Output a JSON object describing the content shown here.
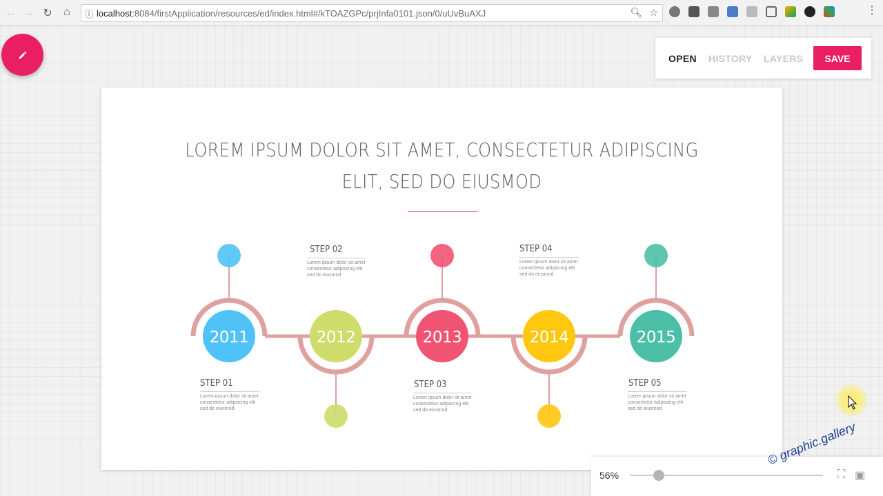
{
  "browser": {
    "url_host": "localhost",
    "url_path": ":8084/firstApplication/resources/ed/index.html#/kTOAZGPc/prjInfa0101.json/0/uUvBuAXJ"
  },
  "toolbar": {
    "open_label": "OPEN",
    "history_label": "HISTORY",
    "layers_label": "LAYERS",
    "save_label": "SAVE"
  },
  "slide": {
    "title_line1": "LOREM IPSUM DOLOR SIT AMET, CONSECTETUR ADIPISCING",
    "title_line2": "ELIT, SED DO EIUSMOD",
    "steps": [
      {
        "label": "STEP 01",
        "year": "2011",
        "color": "#4fc3f7",
        "text1": "Lorem ipsum dolor sit amet",
        "text2": "consectetur adipiscing elit",
        "text3": "sed do eiusmod"
      },
      {
        "label": "STEP 02",
        "year": "2012",
        "color": "#cddc6a",
        "text1": "Lorem ipsum dolor sit amet",
        "text2": "consectetur adipiscing elit",
        "text3": "sed do eiusmod"
      },
      {
        "label": "STEP 03",
        "year": "2013",
        "color": "#ef5472",
        "text1": "Lorem ipsum dolor sit amet",
        "text2": "consectetur adipiscing elit",
        "text3": "sed do eiusmod"
      },
      {
        "label": "STEP 04",
        "year": "2014",
        "color": "#ffc70f",
        "text1": "Lorem ipsum dolor sit amet",
        "text2": "consectetur adipiscing elit",
        "text3": "sed do eiusmod"
      },
      {
        "label": "STEP 05",
        "year": "2015",
        "color": "#4dbfa6",
        "text1": "Lorem ipsum dolor sit amet",
        "text2": "consectetur adipiscing elit",
        "text3": "sed do eiusmod"
      }
    ],
    "arc_color": "#e0a0a0"
  },
  "zoom": {
    "percent_label": "56%",
    "level": 0.56
  },
  "watermark": "© graphic.gallery",
  "colors": {
    "accent": "#e91e63"
  }
}
